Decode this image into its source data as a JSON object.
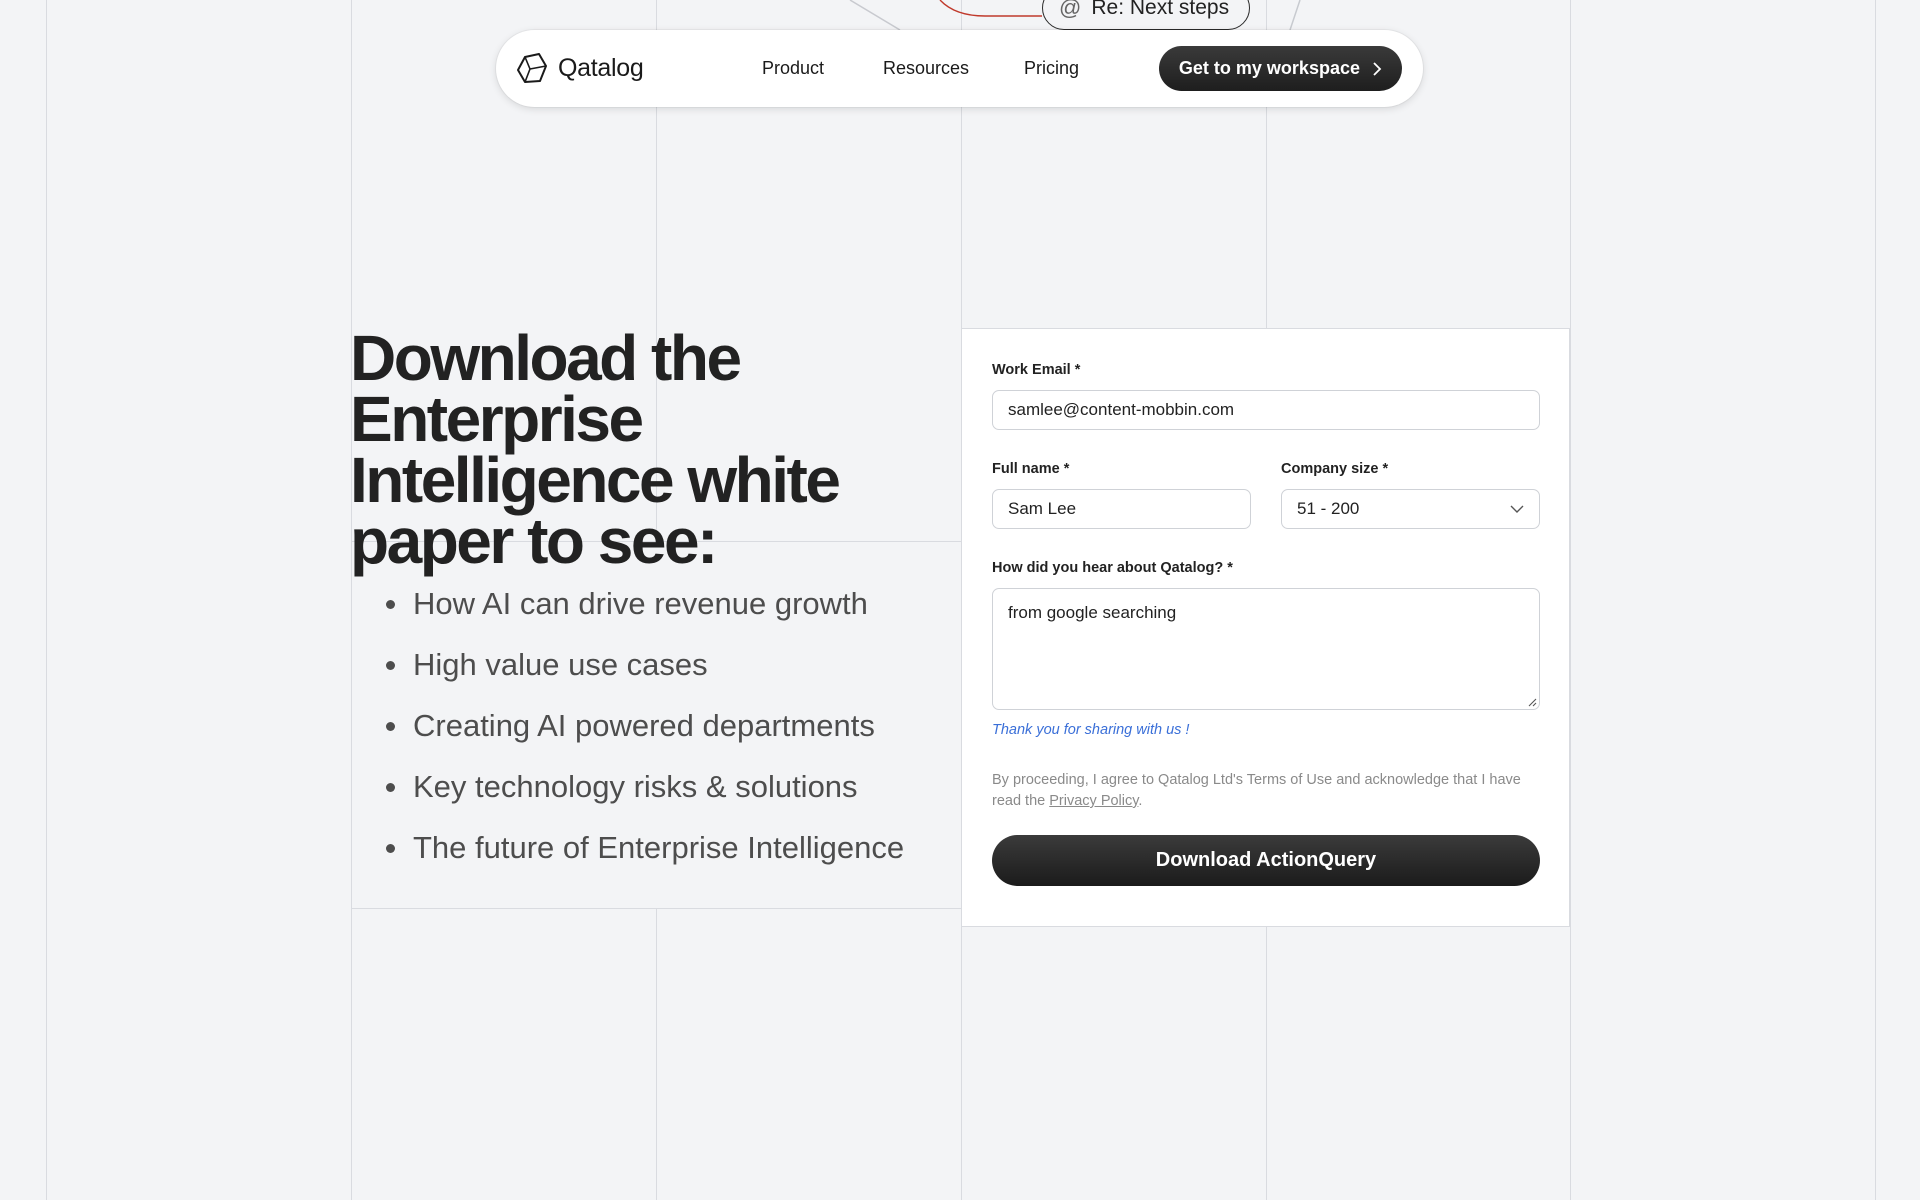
{
  "decoration": {
    "email_chip_text": "Re: Next steps",
    "icon": "at-sign-icon"
  },
  "nav": {
    "brand": "Qatalog",
    "links": [
      "Product",
      "Resources",
      "Pricing"
    ],
    "cta_label": "Get to my workspace",
    "cta_icon": "chevron-right-icon"
  },
  "hero": {
    "title": "Download the Enterprise Intelligence white paper to see:",
    "bullets": [
      "How AI can drive revenue growth",
      "High value use cases",
      "Creating AI powered departments",
      "Key technology risks & solutions",
      "The future of Enterprise Intelligence"
    ]
  },
  "form": {
    "email_label": "Work Email *",
    "email_value": "samlee@content-mobbin.com",
    "name_label": "Full name *",
    "name_value": "Sam Lee",
    "company_label": "Company size *",
    "company_value": "51 - 200",
    "hear_label": "How did you hear about Qatalog? *",
    "hear_value": "from google searching",
    "thanks_note": "Thank you for sharing with us !",
    "legal_text": "By proceeding, I agree to Qatalog Ltd's Terms of Use and acknowledge that I have read the ",
    "legal_link": "Privacy Policy",
    "legal_end": ".",
    "submit_label": "Download ActionQuery"
  },
  "colors": {
    "accent_dark": "#1f1f1f",
    "link_blue": "#3a6fd8",
    "background": "#f3f4f6"
  }
}
